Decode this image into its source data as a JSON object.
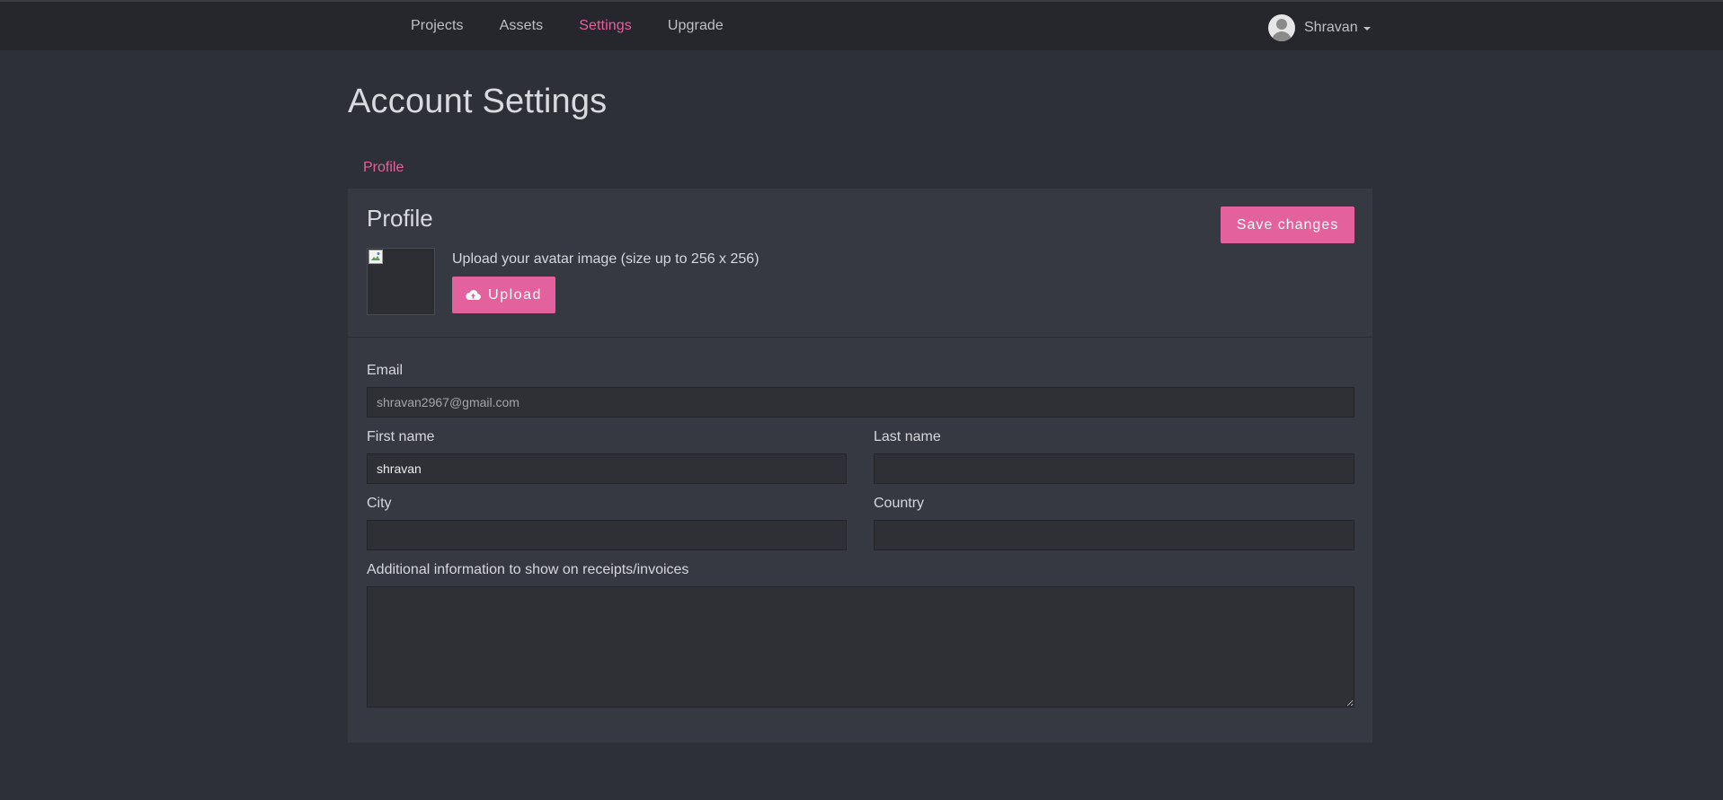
{
  "nav": {
    "links": [
      {
        "label": "Projects"
      },
      {
        "label": "Assets"
      },
      {
        "label": "Settings"
      },
      {
        "label": "Upgrade"
      }
    ],
    "active_index": 2,
    "user_name": "Shravan"
  },
  "page": {
    "title": "Account Settings",
    "tabs": [
      {
        "label": "Profile"
      }
    ]
  },
  "profile": {
    "section_title": "Profile",
    "save_label": "Save changes",
    "upload_text": "Upload your avatar image (size up to 256 x 256)",
    "upload_label": "Upload"
  },
  "form": {
    "email": {
      "label": "Email",
      "value": "shravan2967@gmail.com"
    },
    "first_name": {
      "label": "First name",
      "value": "shravan"
    },
    "last_name": {
      "label": "Last name",
      "value": ""
    },
    "city": {
      "label": "City",
      "value": ""
    },
    "country": {
      "label": "Country",
      "value": ""
    },
    "additional_info": {
      "label": "Additional information to show on receipts/invoices",
      "value": ""
    }
  },
  "colors": {
    "accent": "#e3619c",
    "navbar_bg": "#25272c",
    "page_bg": "#2e3038",
    "panel_bg": "#373942",
    "input_bg": "#2f3036"
  },
  "icons": {
    "upload": "cloud-upload-icon",
    "user_avatar": "user-avatar-icon",
    "caret": "caret-down-icon"
  }
}
